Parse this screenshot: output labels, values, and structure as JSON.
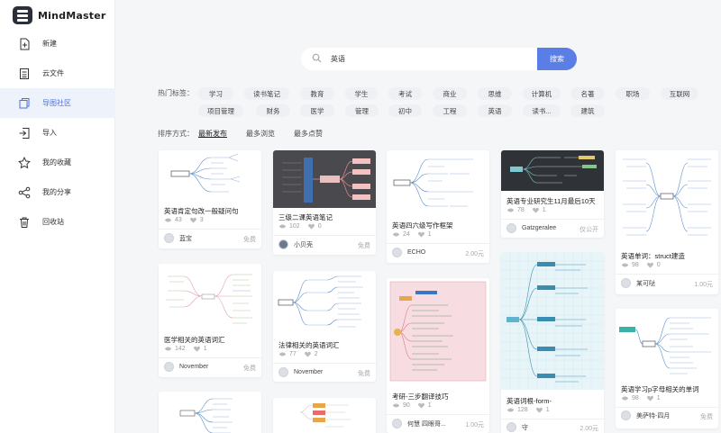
{
  "app": {
    "name": "MindMaster"
  },
  "sidebar": {
    "items": [
      {
        "label": "新建",
        "icon": "new-file-icon"
      },
      {
        "label": "云文件",
        "icon": "cloud-file-icon"
      },
      {
        "label": "导图社区",
        "icon": "community-icon",
        "active": true
      },
      {
        "label": "导入",
        "icon": "import-icon"
      },
      {
        "label": "我的收藏",
        "icon": "star-icon"
      },
      {
        "label": "我的分享",
        "icon": "share-icon"
      },
      {
        "label": "回收站",
        "icon": "trash-icon"
      }
    ]
  },
  "search": {
    "value": "英语",
    "button": "搜索"
  },
  "tags": {
    "label": "热门标签：",
    "items": [
      "学习",
      "读书笔记",
      "教育",
      "学生",
      "考试",
      "商业",
      "思维",
      "计算机",
      "名著",
      "职场",
      "互联网",
      "项目管理",
      "财务",
      "医学",
      "管理",
      "初中",
      "工程",
      "英语",
      "读书...",
      "建筑"
    ]
  },
  "sort": {
    "label": "排序方式：",
    "options": [
      "最新发布",
      "最多浏览",
      "最多点赞"
    ],
    "active": "最新发布"
  },
  "cards": [
    {
      "title": "英语肯定句改一般疑问句",
      "views": "43",
      "likes": "3",
      "author": "蓝宝",
      "price": "免费"
    },
    {
      "title": "医学相关的英语词汇",
      "views": "142",
      "likes": "1",
      "author": "November",
      "price": "免费"
    },
    {
      "title": "",
      "views": "",
      "likes": "",
      "author": "",
      "price": ""
    },
    {
      "title": "三级二课英语笔记",
      "views": "102",
      "likes": "0",
      "author": "小贝壳",
      "price": "免费"
    },
    {
      "title": "法律相关的英语词汇",
      "views": "77",
      "likes": "2",
      "author": "November",
      "price": "免费"
    },
    {
      "title": "",
      "views": "",
      "likes": "",
      "author": "",
      "price": ""
    },
    {
      "title": "英语四六级写作框架",
      "views": "24",
      "likes": "1",
      "author": "ECHO",
      "price": "2.00元"
    },
    {
      "title": "考研-三步翻译技巧",
      "views": "90",
      "likes": "1",
      "author": "何慧 四眼哥...",
      "price": "1.00元"
    },
    {
      "title": "英语专业研究生11月最后10天",
      "views": "78",
      "likes": "1",
      "author": "Gatzgeralee",
      "price": "仅公开"
    },
    {
      "title": "英语词根-form-",
      "views": "128",
      "likes": "1",
      "author": "守",
      "price": "2.00元"
    },
    {
      "title": "英语单词：struct建造",
      "views": "98",
      "likes": "0",
      "author": "某可哒",
      "price": "1.00元"
    },
    {
      "title": "英语学习p字母相关的单词",
      "views": "98",
      "likes": "1",
      "author": "美萨特-四月",
      "price": "免费"
    }
  ],
  "colors": {
    "accent": "#5b7ee6",
    "active_bg": "#eef2fb",
    "active_text": "#4d6fdb"
  }
}
